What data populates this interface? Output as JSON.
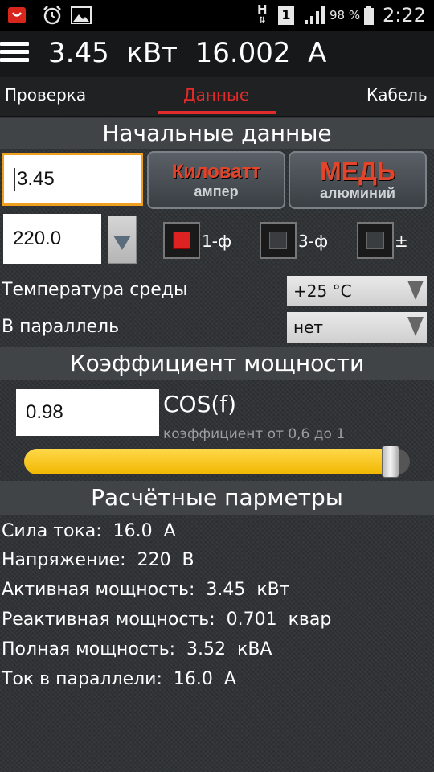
{
  "status_bar": {
    "battery_percent": "98 %",
    "clock": "2:22",
    "sim_slot": "1",
    "data_indicator": "H"
  },
  "header": {
    "title": "3.45  кВт  16.002  А"
  },
  "tabs": [
    {
      "label": "Проверка",
      "active": false
    },
    {
      "label": "Данные",
      "active": true
    },
    {
      "label": "Кабель",
      "active": false
    }
  ],
  "initial_data": {
    "section_title": "Начальные данные",
    "power_value": "3.45",
    "voltage_value": "220.0",
    "unit_button": {
      "top": "Киловатт",
      "bottom": "ампер"
    },
    "material_button": {
      "top": "МЕДЬ",
      "bottom": "алюминий"
    },
    "phase_options": [
      {
        "label": "1-ф",
        "checked": true
      },
      {
        "label": "3-ф",
        "checked": false
      },
      {
        "label": "±",
        "checked": false
      }
    ],
    "temperature_label": "Температура среды",
    "temperature_value": "+25 °C",
    "parallel_label": "В параллель",
    "parallel_value": "нет"
  },
  "power_factor": {
    "section_title": "Коэффициент мощности",
    "value": "0.98",
    "label": "COS(f)",
    "hint": "коэффициент от 0,6 до 1",
    "slider_fraction": 0.95
  },
  "results": {
    "section_title": "Расчётные парметры",
    "lines": [
      "Сила тока:  16.0  А",
      "Напряжение:  220  В",
      "Активная мощность:  3.45  кВт",
      "Реактивная мощность:  0.701  квар",
      "Полная мощность:  3.52  кВА",
      "Ток в параллели:  16.0  А"
    ]
  },
  "colors": {
    "accent_red": "#e22b2b",
    "slider_yellow": "#f5c000",
    "section_bg": "#414447"
  }
}
